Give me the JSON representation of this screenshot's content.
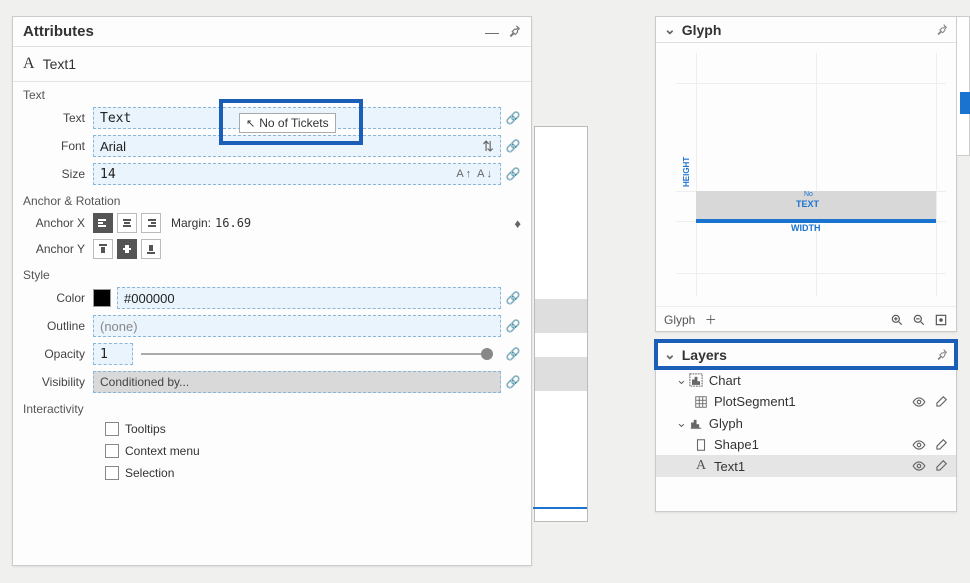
{
  "attributes": {
    "panel_title": "Attributes",
    "object_name": "Text1",
    "sections": {
      "text_label": "Text",
      "anchor_rotation": "Anchor & Rotation",
      "style": "Style",
      "interactivity": "Interactivity"
    },
    "text": {
      "text_label": "Text",
      "text_value": "Text",
      "font_label": "Font",
      "font_value": "Arial",
      "size_label": "Size",
      "size_value": "14"
    },
    "anchor": {
      "x_label": "Anchor X",
      "y_label": "Anchor Y",
      "margin_label": "Margin:",
      "margin_value": "16.69"
    },
    "style_props": {
      "color_label": "Color",
      "color_value": "#000000",
      "outline_label": "Outline",
      "outline_value": "(none)",
      "opacity_label": "Opacity",
      "opacity_value": "1",
      "visibility_label": "Visibility",
      "visibility_value": "Conditioned by..."
    },
    "interactivity": {
      "tooltips": "Tooltips",
      "context_menu": "Context menu",
      "selection": "Selection"
    },
    "tooltip_chip": "No of Tickets"
  },
  "glyph": {
    "panel_title": "Glyph",
    "height_label": "HEIGHT",
    "text_label": "TEXT",
    "width_label": "WIDTH",
    "no_label": "No",
    "footer_label": "Glyph"
  },
  "layers": {
    "panel_title": "Layers",
    "items": [
      {
        "name": "Chart",
        "icon": "chart",
        "indent": 0,
        "expand": true,
        "selected": false,
        "actions": false
      },
      {
        "name": "PlotSegment1",
        "icon": "grid",
        "indent": 1,
        "expand": false,
        "selected": false,
        "actions": true
      },
      {
        "name": "Glyph",
        "icon": "glyph",
        "indent": 0,
        "expand": true,
        "selected": false,
        "actions": false
      },
      {
        "name": "Shape1",
        "icon": "shape",
        "indent": 1,
        "expand": false,
        "selected": false,
        "actions": true
      },
      {
        "name": "Text1",
        "icon": "text",
        "indent": 1,
        "expand": false,
        "selected": true,
        "actions": true
      }
    ]
  }
}
